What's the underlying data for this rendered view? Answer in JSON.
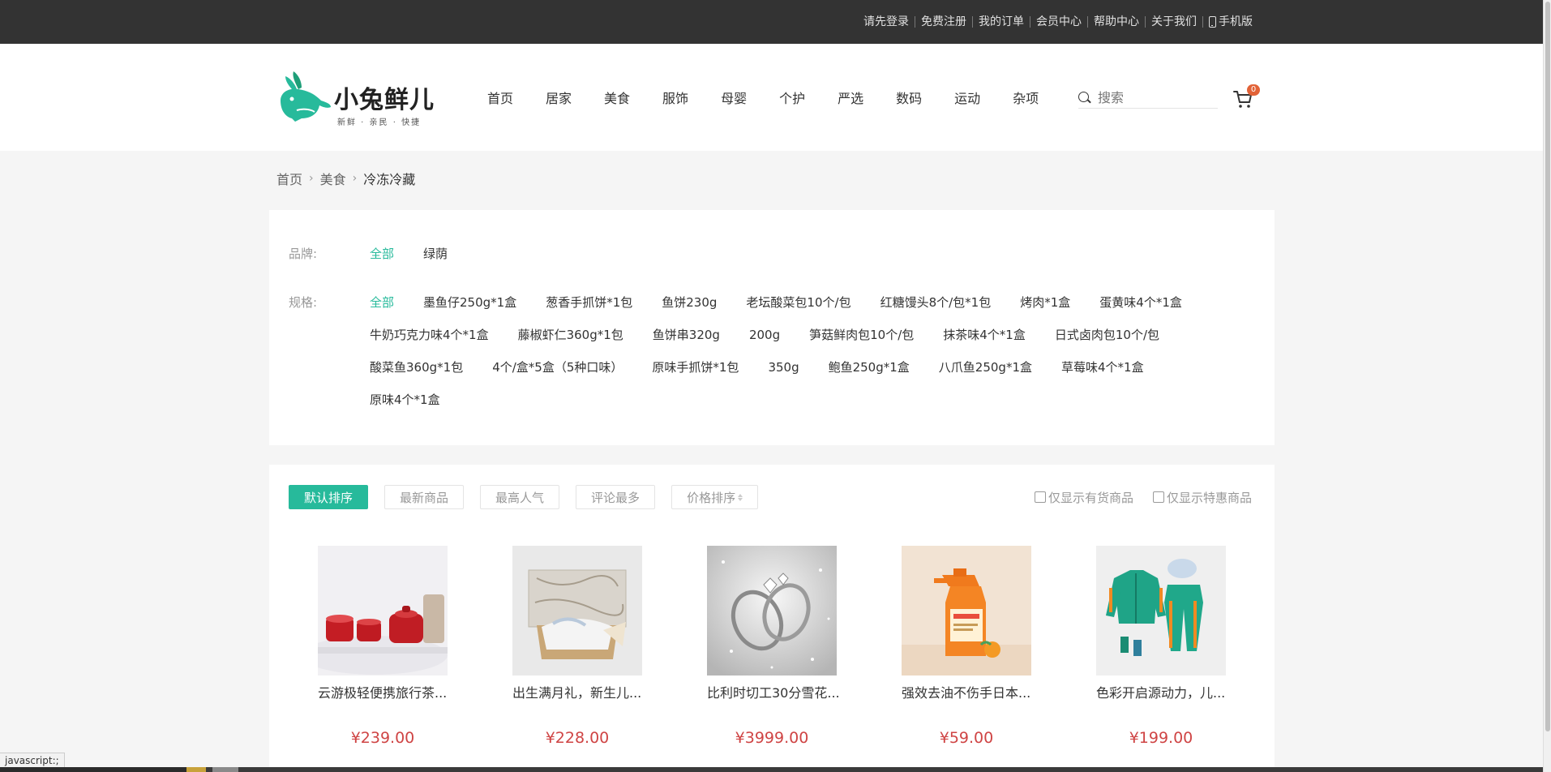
{
  "topbar": {
    "links": [
      "请先登录",
      "免费注册",
      "我的订单",
      "会员中心",
      "帮助中心",
      "关于我们"
    ],
    "mobile_label": "手机版"
  },
  "header": {
    "logo_text": "小兔鲜儿",
    "logo_slogan": "新鲜 · 亲民 · 快捷",
    "nav": [
      "首页",
      "居家",
      "美食",
      "服饰",
      "母婴",
      "个护",
      "严选",
      "数码",
      "运动",
      "杂项"
    ],
    "search_placeholder": "搜索",
    "cart_count": "0"
  },
  "breadcrumb": {
    "home": "首页",
    "category": "美食",
    "current": "冷冻冷藏"
  },
  "filters": {
    "brand": {
      "label": "品牌:",
      "options": [
        "全部",
        "绿荫"
      ]
    },
    "spec": {
      "label": "规格:",
      "options": [
        "全部",
        "墨鱼仔250g*1盒",
        "葱香手抓饼*1包",
        "鱼饼230g",
        "老坛酸菜包10个/包",
        "红糖馒头8个/包*1包",
        "烤肉*1盒",
        "蛋黄味4个*1盒",
        "牛奶巧克力味4个*1盒",
        "藤椒虾仁360g*1包",
        "鱼饼串320g",
        "200g",
        "笋菇鲜肉包10个/包",
        "抹茶味4个*1盒",
        "日式卤肉包10个/包",
        "酸菜鱼360g*1包",
        "4个/盒*5盒（5种口味）",
        "原味手抓饼*1包",
        "350g",
        "鲍鱼250g*1盒",
        "八爪鱼250g*1盒",
        "草莓味4个*1盒",
        "原味4个*1盒"
      ]
    }
  },
  "sort": {
    "buttons": [
      "默认排序",
      "最新商品",
      "最高人气",
      "评论最多"
    ],
    "price_label": "价格排序",
    "in_stock_label": "仅显示有货商品",
    "on_sale_label": "仅显示特惠商品"
  },
  "goods": [
    {
      "name": "云游极轻便携旅行茶...",
      "price": "¥239.00",
      "image": "red-tea-set"
    },
    {
      "name": "出生满月礼，新生儿...",
      "price": "¥228.00",
      "image": "baby-gift-box"
    },
    {
      "name": "比利时切工30分雪花...",
      "price": "¥3999.00",
      "image": "diamond-rings"
    },
    {
      "name": "强效去油不伤手日本...",
      "price": "¥59.00",
      "image": "cleaner-spray"
    },
    {
      "name": "色彩开启源动力，儿...",
      "price": "¥199.00",
      "image": "kids-sportswear"
    }
  ],
  "statusbar": "javascript:;",
  "colors": {
    "accent": "#27ba9b",
    "price": "#cf4444",
    "topbar": "#333333",
    "badge": "#e26237"
  }
}
